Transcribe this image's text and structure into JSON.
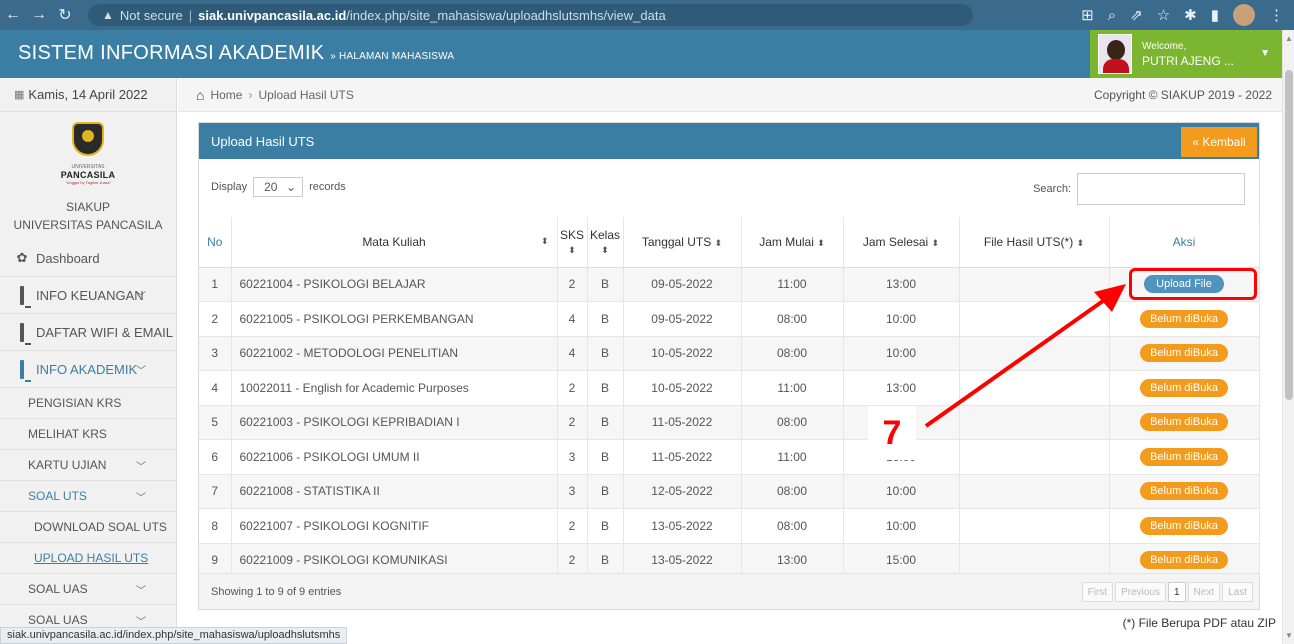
{
  "browser": {
    "security_label": "Not secure",
    "url_domain": "siak.univpancasila.ac.id",
    "url_path": "/index.php/site_mahasiswa/uploadhslutsmhs/view_data",
    "status_url": "siak.univpancasila.ac.id/index.php/site_mahasiswa/uploadhslutsmhs"
  },
  "header": {
    "title": "SISTEM INFORMASI AKADEMIK",
    "subtitle": "» HALAMAN MAHASISWA",
    "welcome": "Welcome,",
    "user_name": "PUTRI AJENG ..."
  },
  "sidebar": {
    "date": "Kamis, 14 April 2022",
    "logo_small": "UNIVERSITAS",
    "logo_name": "PANCASILA",
    "logo_tag": "\"Unggul by Tagline Juara\"",
    "siakup_label": "SIAKUP",
    "university": "UNIVERSITAS PANCASILA",
    "menu": {
      "dashboard": "Dashboard",
      "info_keuangan": "INFO KEUANGAN",
      "daftar_wifi": "DAFTAR WIFI & EMAIL",
      "info_akademik": "INFO AKADEMIK",
      "pengisian_krs": "PENGISIAN KRS",
      "melihat_krs": "MELIHAT KRS",
      "kartu_ujian": "KARTU UJIAN",
      "soal_uts": "SOAL UTS",
      "download_soal_uts": "DOWNLOAD SOAL UTS",
      "upload_hasil_uts": "UPLOAD HASIL UTS",
      "soal_uas": "SOAL UAS",
      "soal_uas_2": "SOAL UAS"
    }
  },
  "breadcrumb": {
    "home": "Home",
    "current": "Upload Hasil UTS",
    "copyright": "Copyright © SIAKUP 2019 - 2022"
  },
  "panel": {
    "title": "Upload Hasil UTS",
    "back_label": "« Kembali",
    "display_label": "Display",
    "display_value": "20",
    "records_label": "records",
    "search_label": "Search:",
    "search_value": ""
  },
  "table": {
    "headers": {
      "no": "No",
      "mata_kuliah": "Mata Kuliah",
      "sks": "SKS",
      "kelas": "Kelas",
      "tanggal": "Tanggal UTS",
      "jam_mulai": "Jam Mulai",
      "jam_selesai": "Jam Selesai",
      "file": "File Hasil UTS(*)",
      "aksi": "Aksi"
    },
    "rows": [
      {
        "no": "1",
        "mk": "60221004 - PSIKOLOGI BELAJAR",
        "sks": "2",
        "kelas": "B",
        "tgl": "09-05-2022",
        "mulai": "11:00",
        "selesai": "13:00",
        "file": "",
        "aksi": "Upload File"
      },
      {
        "no": "2",
        "mk": "60221005 - PSIKOLOGI PERKEMBANGAN",
        "sks": "4",
        "kelas": "B",
        "tgl": "09-05-2022",
        "mulai": "08:00",
        "selesai": "10:00",
        "file": "",
        "aksi": "Belum diBuka"
      },
      {
        "no": "3",
        "mk": "60221002 - METODOLOGI PENELITIAN",
        "sks": "4",
        "kelas": "B",
        "tgl": "10-05-2022",
        "mulai": "08:00",
        "selesai": "10:00",
        "file": "",
        "aksi": "Belum diBuka"
      },
      {
        "no": "4",
        "mk": "10022011 - English for Academic Purposes",
        "sks": "2",
        "kelas": "B",
        "tgl": "10-05-2022",
        "mulai": "11:00",
        "selesai": "13:00",
        "file": "",
        "aksi": "Belum diBuka"
      },
      {
        "no": "5",
        "mk": "60221003 - PSIKOLOGI KEPRIBADIAN I",
        "sks": "2",
        "kelas": "B",
        "tgl": "11-05-2022",
        "mulai": "08:00",
        "selesai": "10:00",
        "file": "",
        "aksi": "Belum diBuka"
      },
      {
        "no": "6",
        "mk": "60221006 - PSIKOLOGI UMUM II",
        "sks": "3",
        "kelas": "B",
        "tgl": "11-05-2022",
        "mulai": "11:00",
        "selesai": "13:00",
        "file": "",
        "aksi": "Belum diBuka"
      },
      {
        "no": "7",
        "mk": "60221008 - STATISTIKA II",
        "sks": "3",
        "kelas": "B",
        "tgl": "12-05-2022",
        "mulai": "08:00",
        "selesai": "10:00",
        "file": "",
        "aksi": "Belum diBuka"
      },
      {
        "no": "8",
        "mk": "60221007 - PSIKOLOGI KOGNITIF",
        "sks": "2",
        "kelas": "B",
        "tgl": "13-05-2022",
        "mulai": "08:00",
        "selesai": "10:00",
        "file": "",
        "aksi": "Belum diBuka"
      },
      {
        "no": "9",
        "mk": "60221009 - PSIKOLOGI KOMUNIKASI",
        "sks": "2",
        "kelas": "B",
        "tgl": "13-05-2022",
        "mulai": "13:00",
        "selesai": "15:00",
        "file": "",
        "aksi": "Belum diBuka"
      }
    ]
  },
  "footer": {
    "showing": "Showing 1 to 9 of 9 entries",
    "pager": {
      "first": "First",
      "previous": "Previous",
      "page": "1",
      "next": "Next",
      "last": "Last"
    },
    "note": "(*) File Berupa PDF atau ZIP"
  },
  "annotation": {
    "step": "7",
    "color": "#ff0000"
  },
  "colors": {
    "header_blue": "#3a7fa3",
    "user_green": "#7cb530",
    "accent_orange": "#f29b1d",
    "upload_blue": "#4f93be"
  }
}
